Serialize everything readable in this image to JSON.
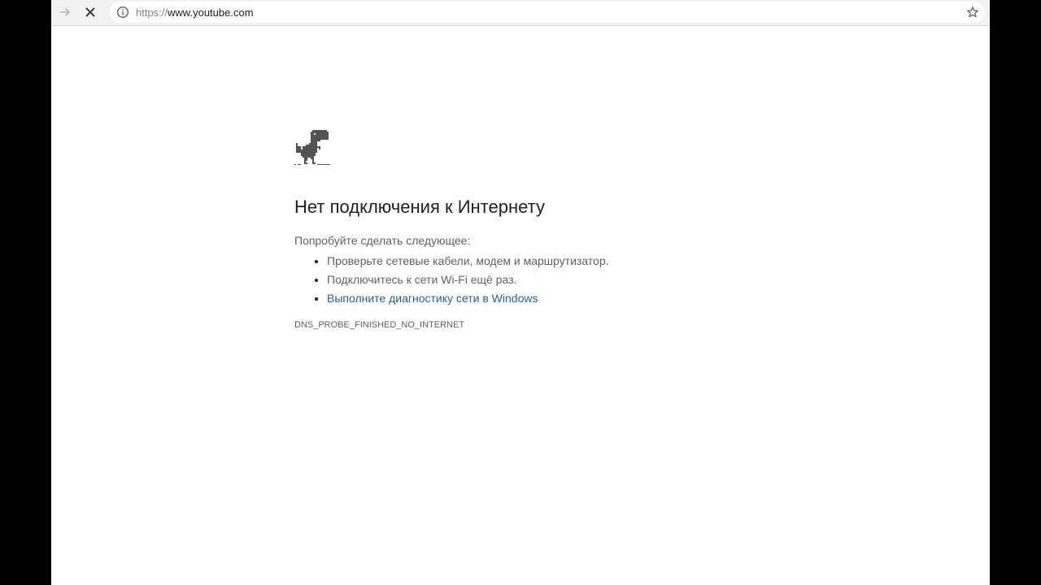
{
  "browser": {
    "url_scheme": "https://",
    "url_host": "www.youtube.com",
    "icons": {
      "forward": "forward-arrow-icon",
      "stop": "stop-x-icon",
      "site_info": "info-icon",
      "bookmark": "star-icon"
    }
  },
  "page": {
    "title": "Нет подключения к Интернету",
    "suggestions_heading": "Попробуйте сделать следующее:",
    "suggestions": [
      "Проверьте сетевые кабели, модем и маршрутизатор.",
      "Подключитесь к сети Wi-Fi ещё раз.",
      "Выполните диагностику сети в Windows"
    ],
    "error_code": "DNS_PROBE_FINISHED_NO_INTERNET"
  },
  "colors": {
    "toolbar_bg": "#f2f2f2",
    "link": "#2a6196",
    "text": "#5f6368",
    "title": "#202124",
    "dino": "#535353"
  }
}
